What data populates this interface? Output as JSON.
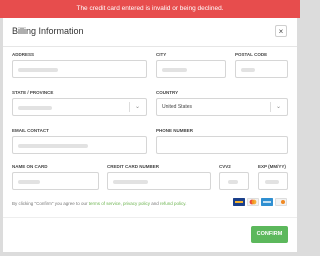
{
  "error_banner": {
    "text": "The credit card entered is invalid or being declined."
  },
  "modal": {
    "title": "Billing Information",
    "close_symbol": "×"
  },
  "form": {
    "address_label": "ADDRESS",
    "city_label": "CITY",
    "postal_code_label": "POSTAL CODE",
    "state_label": "STATE / PROVINCE",
    "country_label": "COUNTRY",
    "country_value": "United States",
    "email_label": "EMAIL CONTACT",
    "phone_label": "PHONE NUMBER",
    "name_on_card_label": "NAME ON CARD",
    "card_number_label": "CREDIT CARD NUMBER",
    "cvv_label": "CVV2",
    "exp_label": "EXP (MM/YY)"
  },
  "terms": {
    "prefix": "By clicking \"Confirm\" you agree to our ",
    "tos": "terms of service",
    "sep": ", ",
    "privacy": "privacy policy",
    "and": " and ",
    "refund": "refund policy",
    "suffix": "."
  },
  "card_icons": [
    "visa-icon",
    "mastercard-icon",
    "amex-icon",
    "discover-icon"
  ],
  "confirm_label": "CONFIRM",
  "colors": {
    "error": "#e74d4d",
    "accent": "#5cb85c",
    "link": "#6bb34e"
  }
}
